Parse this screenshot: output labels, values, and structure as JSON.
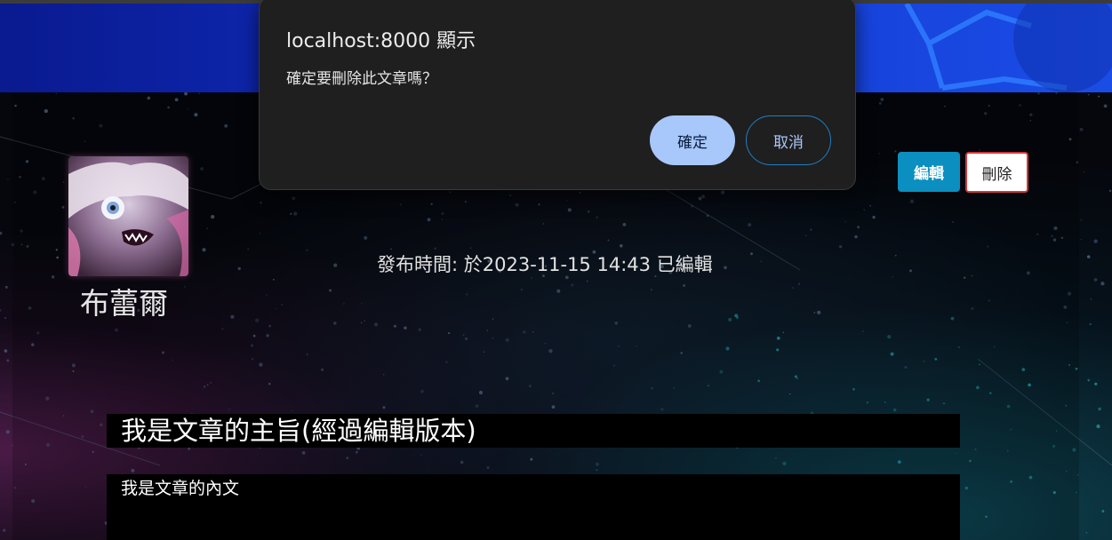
{
  "dialog": {
    "title": "localhost:8000 顯示",
    "message": "確定要刪除此文章嗎？",
    "ok_label": "確定",
    "cancel_label": "取消"
  },
  "post": {
    "author_name": "布蕾爾",
    "publish_time": "發布時間: 於2023-11-15 14:43 已編輯",
    "edit_label": "編輯",
    "delete_label": "刪除",
    "title": "我是文章的主旨(經過編輯版本)",
    "content": "我是文章的內文"
  },
  "colors": {
    "banner": "#1640d8",
    "edit_button": "#0a8fc0",
    "delete_border": "#d03a3a",
    "dialog_ok": "#a8c7fa",
    "dialog_bg": "#1f1f1f"
  }
}
